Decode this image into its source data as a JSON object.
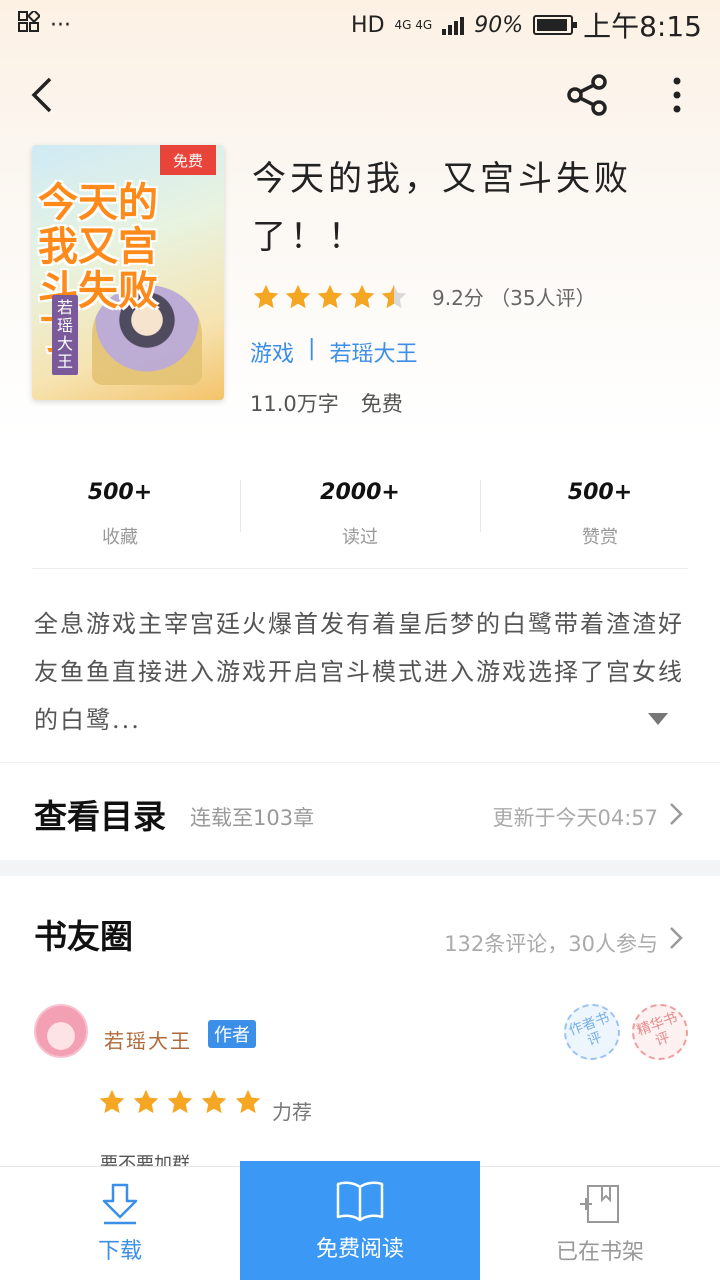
{
  "status_bar": {
    "network": "HD",
    "signal_labels": "4G 4G",
    "battery_percent": "90%",
    "time": "上午8:15"
  },
  "nav": {
    "back_icon": "chevron-left-icon",
    "share_icon": "share-icon",
    "more_icon": "more-vertical-icon"
  },
  "book": {
    "cover_badge": "免费",
    "cover_title": "今天的我又宫斗失败了",
    "cover_author": "若瑶大王",
    "title": "今天的我，又宫斗失败了！！",
    "rating_value": 4.5,
    "rating_max": 5,
    "rating_text": "9.2分 （35人评）",
    "category": "游戏",
    "separator": "|",
    "author": "若瑶大王",
    "word_count": "11.0万字",
    "price": "免费"
  },
  "stats": [
    {
      "value": "500+",
      "label": "收藏"
    },
    {
      "value": "2000+",
      "label": "读过"
    },
    {
      "value": "500+",
      "label": "赞赏"
    }
  ],
  "description": "全息游戏主宰宫廷火爆首发有着皇后梦的白鹭带着渣渣好友鱼鱼直接进入游戏开启宫斗模式进入游戏选择了宫女线的白鹭...",
  "catalog": {
    "title": "查看目录",
    "count": "连载至103章",
    "update": "更新于今天04:57"
  },
  "circle": {
    "title": "书友圈",
    "meta": "132条评论，30人参与",
    "review": {
      "author": "若瑶大王",
      "author_badge": "作者",
      "stamp_author": "作者书评",
      "stamp_select": "精华书评",
      "stars": 5,
      "text": "力荐",
      "cut_text": "要不要加群"
    }
  },
  "bottom_bar": {
    "download": "下载",
    "read": "免费阅读",
    "shelf": "已在书架"
  },
  "colors": {
    "accent": "#3c98f5",
    "star": "#f5a623",
    "link": "#3d8ee6"
  }
}
